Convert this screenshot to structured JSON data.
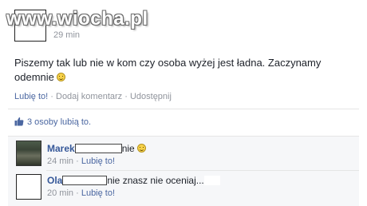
{
  "watermark": {
    "text": "www.wiocha.pl"
  },
  "post": {
    "time": "29 min",
    "text": "Piszemy tak lub nie w kom czy osoba wyżej jest ładna. Zaczynamy odemnie",
    "emoji_icon": "smiley-icon",
    "actions": {
      "like": "Lubię to!",
      "comment": "Dodaj komentarz",
      "share": "Udostępnij",
      "separator": "·"
    },
    "likes_text": "3 osoby lubią to.",
    "likes_icon": "thumbs-up-icon"
  },
  "comments": [
    {
      "name": "Marek",
      "text": "nie",
      "emoji_icon": "smiley-icon",
      "time": "24 min",
      "like": "Lubię to!",
      "separator": "·"
    },
    {
      "name": "Ola",
      "text": "nie znasz nie oceniaj...",
      "time": "20 min",
      "like": "Lubię to!",
      "separator": "·"
    }
  ],
  "colors": {
    "link": "#4b67a1",
    "name": "#365899",
    "meta": "#90949c",
    "comment_bg": "#f6f7f9"
  }
}
